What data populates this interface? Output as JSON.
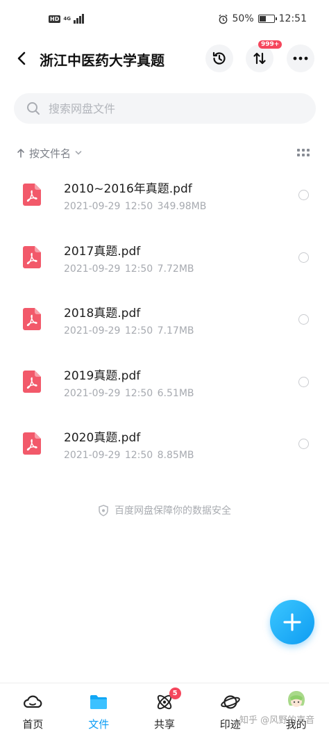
{
  "status_bar": {
    "hd": "HD",
    "network": "4G",
    "battery": "50%",
    "battery_level": 0.5,
    "time": "12:51"
  },
  "header": {
    "title": "浙江中医药大学真题",
    "transfer_badge": "999+"
  },
  "search": {
    "placeholder": "搜索网盘文件"
  },
  "sort": {
    "label": "按文件名"
  },
  "files": [
    {
      "name": "2010~2016年真题.pdf",
      "date": "2021-09-29",
      "time": "12:50",
      "size": "349.98MB"
    },
    {
      "name": "2017真题.pdf",
      "date": "2021-09-29",
      "time": "12:50",
      "size": "7.72MB"
    },
    {
      "name": "2018真题.pdf",
      "date": "2021-09-29",
      "time": "12:50",
      "size": "7.17MB"
    },
    {
      "name": "2019真题.pdf",
      "date": "2021-09-29",
      "time": "12:50",
      "size": "6.51MB"
    },
    {
      "name": "2020真题.pdf",
      "date": "2021-09-29",
      "time": "12:50",
      "size": "8.85MB"
    }
  ],
  "safety_note": "百度网盘保障你的数据安全",
  "bottom_nav": [
    {
      "label": "首页"
    },
    {
      "label": "文件"
    },
    {
      "label": "共享",
      "badge": "5"
    },
    {
      "label": "印迹"
    },
    {
      "label": "我的"
    }
  ],
  "watermark": "知乎 @风野的声音",
  "colors": {
    "accent": "#0b9df5",
    "badge": "#f5465c",
    "pdf": "#f2596a"
  }
}
